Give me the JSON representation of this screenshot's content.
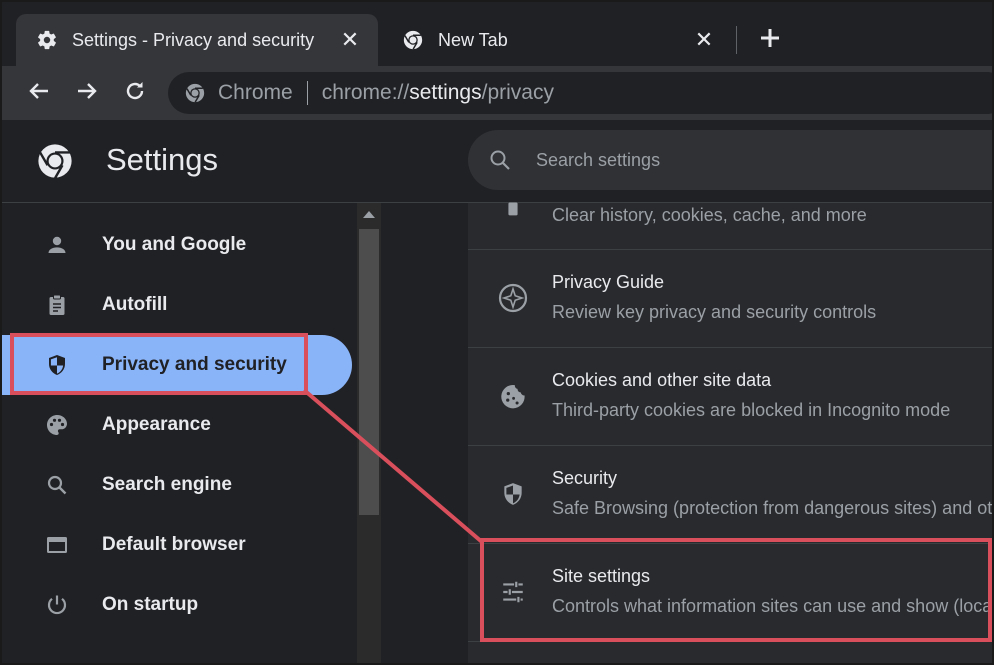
{
  "tabs": [
    {
      "title": "Settings - Privacy and security",
      "icon": "gear-icon",
      "active": true
    },
    {
      "title": "New Tab",
      "icon": "chrome-icon",
      "active": false
    }
  ],
  "tab_close_glyph": "✕",
  "new_tab_icon": "plus-icon",
  "omnibox": {
    "chip": "Chrome",
    "url_scheme": "chrome://",
    "url_host": "settings",
    "url_path": "/privacy"
  },
  "header": {
    "title": "Settings",
    "search_placeholder": "Search settings"
  },
  "sidebar": {
    "items": [
      {
        "label": "You and Google",
        "icon": "person-icon"
      },
      {
        "label": "Autofill",
        "icon": "clipboard-icon"
      },
      {
        "label": "Privacy and security",
        "icon": "shield-icon",
        "selected": true
      },
      {
        "label": "Appearance",
        "icon": "palette-icon"
      },
      {
        "label": "Search engine",
        "icon": "search-icon"
      },
      {
        "label": "Default browser",
        "icon": "browser-window-icon"
      },
      {
        "label": "On startup",
        "icon": "power-icon"
      }
    ]
  },
  "content": {
    "rows": [
      {
        "title": "",
        "subtitle": "Clear history, cookies, cache, and more",
        "icon": "trash-icon"
      },
      {
        "title": "Privacy Guide",
        "subtitle": "Review key privacy and security controls",
        "icon": "compass-icon"
      },
      {
        "title": "Cookies and other site data",
        "subtitle": "Third-party cookies are blocked in Incognito mode",
        "icon": "cookie-icon"
      },
      {
        "title": "Security",
        "subtitle": "Safe Browsing (protection from dangerous sites) and other security settings",
        "icon": "shield-icon"
      },
      {
        "title": "Site settings",
        "subtitle": "Controls what information sites can use and show (location, camera, pop-ups, and more)",
        "icon": "tune-icon"
      }
    ]
  },
  "colors": {
    "highlight": "#d9505c",
    "accent": "#8ab4f8",
    "background": "#202124"
  }
}
